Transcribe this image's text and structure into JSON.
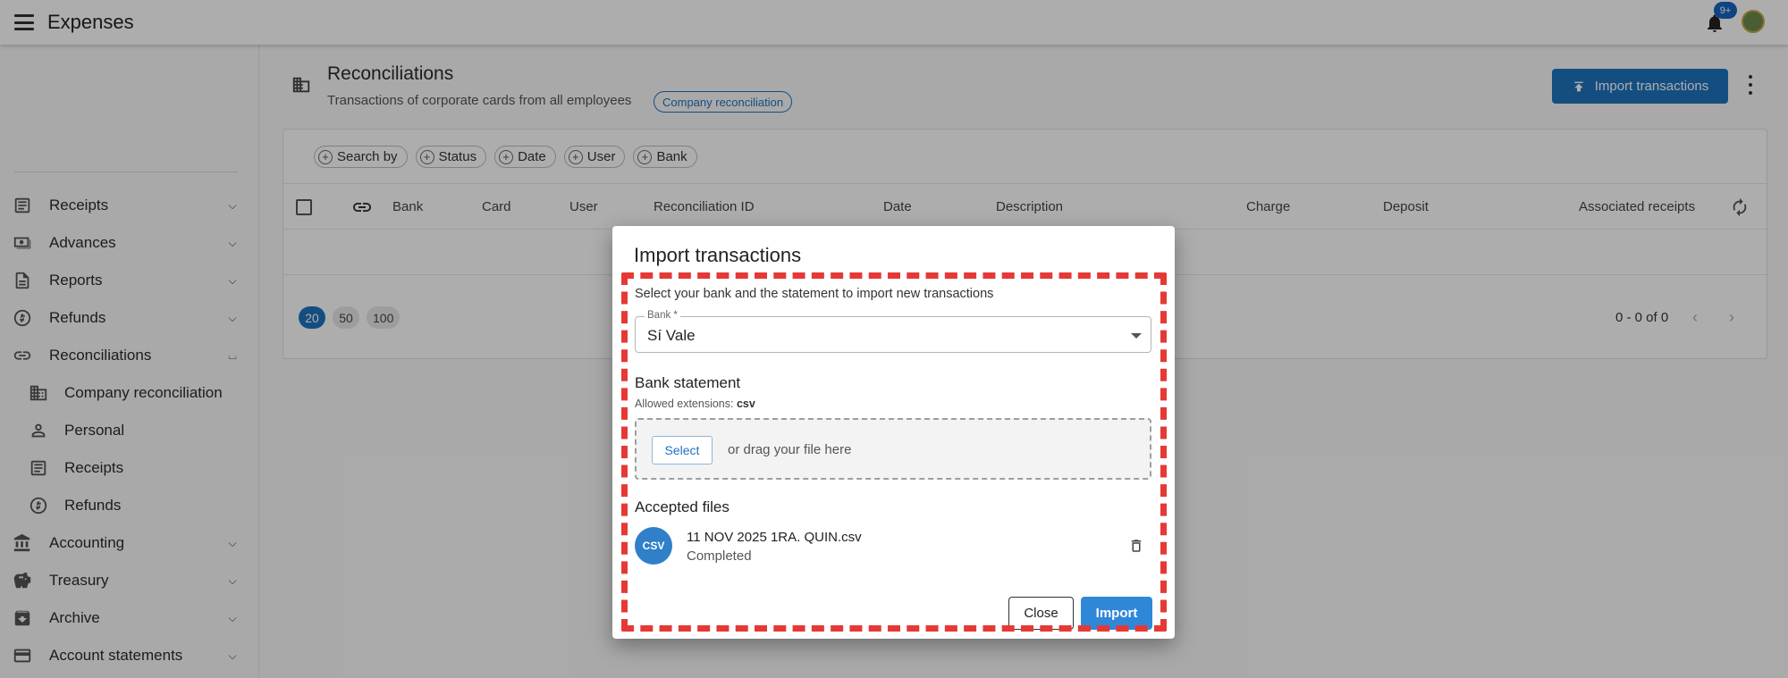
{
  "app": {
    "title": "Expenses",
    "notification_badge": "9+"
  },
  "sidebar": {
    "items": [
      {
        "label": "Receipts",
        "icon": "receipt-icon",
        "expanded": false
      },
      {
        "label": "Advances",
        "icon": "cash-icon",
        "expanded": false
      },
      {
        "label": "Reports",
        "icon": "report-icon",
        "expanded": false
      },
      {
        "label": "Refunds",
        "icon": "refund-icon",
        "expanded": false
      },
      {
        "label": "Reconciliations",
        "icon": "link-icon",
        "expanded": true
      },
      {
        "label": "Accounting",
        "icon": "bank-icon",
        "expanded": false
      },
      {
        "label": "Treasury",
        "icon": "piggy-bank-icon",
        "expanded": false
      },
      {
        "label": "Archive",
        "icon": "archive-icon",
        "expanded": false
      },
      {
        "label": "Account statements",
        "icon": "card-icon",
        "expanded": false
      }
    ],
    "sub_items": [
      {
        "label": "Company reconciliation",
        "icon": "building-icon"
      },
      {
        "label": "Personal",
        "icon": "person-icon"
      },
      {
        "label": "Receipts",
        "icon": "receipt-icon"
      },
      {
        "label": "Refunds",
        "icon": "refund-icon"
      }
    ]
  },
  "page": {
    "title": "Reconciliations",
    "subtitle": "Transactions of corporate cards from all employees",
    "chip": "Company reconciliation",
    "import_button": "Import transactions"
  },
  "filters": [
    "Search by",
    "Status",
    "Date",
    "User",
    "Bank"
  ],
  "table": {
    "columns": [
      "Bank",
      "Card",
      "User",
      "Reconciliation ID",
      "Date",
      "Description",
      "Charge",
      "Deposit",
      "Associated receipts"
    ]
  },
  "pagination": {
    "sizes": [
      "20",
      "50",
      "100"
    ],
    "active_size": "20",
    "range": "0 - 0 of 0"
  },
  "dialog": {
    "title": "Import transactions",
    "instructions": "Select your bank and the statement to import new transactions",
    "bank_label": "Bank *",
    "bank_value": "Sí Vale",
    "statement_title": "Bank statement",
    "extensions_label": "Allowed extensions:",
    "extensions_value": "csv",
    "select_button": "Select",
    "drag_text": "or drag your file here",
    "accepted_title": "Accepted files",
    "file": {
      "badge": "CSV",
      "name": "11 NOV 2025 1RA. QUIN.csv",
      "status": "Completed"
    },
    "close_button": "Close",
    "import_button": "Import"
  },
  "colors": {
    "primary": "#1e73be",
    "highlight": "#e53935"
  }
}
